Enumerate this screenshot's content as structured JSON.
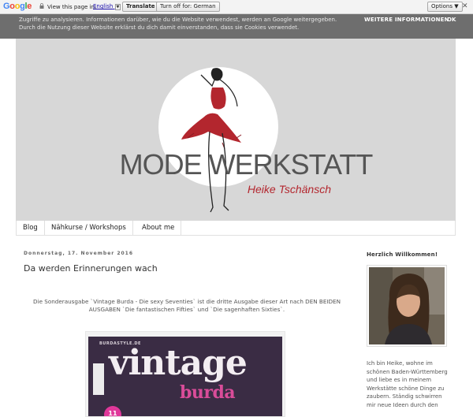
{
  "translate_bar": {
    "logo_letters": [
      "G",
      "o",
      "o",
      "g",
      "l",
      "e"
    ],
    "view_text": "View this page in:",
    "language": "English",
    "translate_label": "Translate",
    "turn_off_label": "Turn off for: German",
    "options_label": "Options ▼",
    "close_label": "✕"
  },
  "cookie": {
    "text": "Zugriffe zu analysieren. Informationen darüber, wie du die Website verwendest, werden an Google weitergegeben. Durch die Nutzung dieser Website erklärst du dich damit einverstanden, dass sie Cookies verwendet.",
    "more_label": "WEITERE INFORMATIONEN",
    "ok_label": "OK"
  },
  "header": {
    "title": "MODE WERKSTATT",
    "subtitle": "Heike Tschänsch",
    "colors": {
      "dress": "#b3262e",
      "circle": "#ffffff",
      "banner": "#d7d7d7"
    }
  },
  "tabs": [
    {
      "label": "Blog"
    },
    {
      "label": "Nähkurse / Workshops"
    },
    {
      "label": "About me"
    }
  ],
  "post": {
    "date": "Donnerstag, 17. November 2016",
    "title": "Da werden Erinnerungen wach",
    "body": "Die Sonderausgabe `Vintage Burda - Die sexy Seventies` ist die dritte Ausgabe dieser Art nach DEN BEIDEN AUSGABEN `Die fantastischen Fifties` und `Die sagenhaften Sixties`.",
    "image": {
      "masthead": "BURDASTYLE.DE",
      "word1": "vintage",
      "word2": "burda",
      "badge": "11"
    }
  },
  "sidebar": {
    "title": "Herzlich Willkommen!",
    "text": "Ich bin Heike, wohne im schönen Baden-Württemberg und liebe es in meinem Werkstätte schöne Dinge zu zaubern. Ständig schwirren mir neue Ideen durch den"
  }
}
